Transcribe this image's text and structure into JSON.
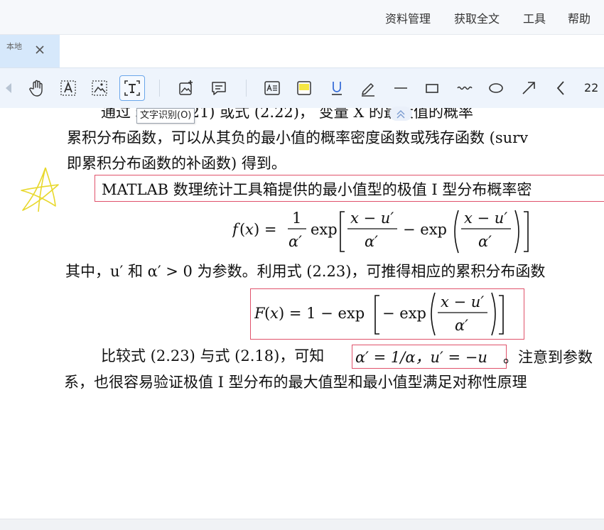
{
  "menu": {
    "items": [
      "资料管理",
      "获取全文",
      "工具",
      "帮助"
    ]
  },
  "tab": {
    "label": "本地"
  },
  "toolbar": {
    "zoom_value": "22",
    "tooltip": "文字识别(O)",
    "icons": [
      "hand-icon",
      "text-select-icon",
      "image-select-icon",
      "ocr-text-icon",
      "image-add-icon",
      "comment-icon",
      "textbox-icon",
      "highlight-icon",
      "underline-icon",
      "pen-icon",
      "line-icon",
      "rectangle-icon",
      "wave-icon",
      "ellipse-icon",
      "arrow-icon",
      "chevron-left-icon"
    ]
  },
  "document": {
    "line1": "通过 理式 (2.21) 或式 (2.22)，    变量 X 的最大值的概率",
    "line2": "累积分布函数，可以从其负的最小值的概率密度函数或残存函数 (surv",
    "line3": "即累积分布函数的补函数) 得到。",
    "line4": "MATLAB 数理统计工具箱提供的最小值型的极值 I 型分布概率密",
    "formula1": "f(x) = 1/α′ exp[(x − u′)/α′ − exp((x − u′)/α′)]",
    "line5": "其中，u′ 和 α′ > 0 为参数。利用式 (2.23)，可推得相应的累积分布函数",
    "formula2": "F(x) = 1 − exp[−exp((x − u′)/α′)]",
    "line6a": "比较式 (2.23) 与式 (2.18)，可知",
    "line6b": "α′ = 1/α，u′ = −u",
    "line6c": "。注意到参数",
    "line7": "系，也很容易验证极值 I 型分布的最大值型和最小值型满足对称性原理"
  }
}
